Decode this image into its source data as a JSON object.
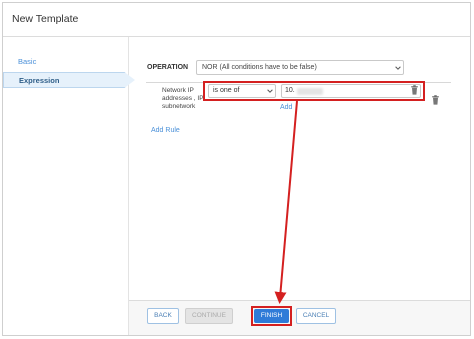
{
  "window": {
    "title": "New Template"
  },
  "sidebar": {
    "items": [
      {
        "label": "Basic",
        "active": false
      },
      {
        "label": "Expression",
        "active": true
      }
    ]
  },
  "operation": {
    "label": "OPERATION",
    "selected": "NOR (All conditions have to be false)"
  },
  "rule": {
    "field_label": "Network IP addresses , IP subnetwork",
    "condition": "is one of",
    "value": "10.",
    "add_label": "Add"
  },
  "add_rule_label": "Add Rule",
  "footer": {
    "back": "BACK",
    "continue": "CONTINUE",
    "finish": "FINISH",
    "cancel": "CANCEL"
  },
  "colors": {
    "accent": "#2f7bd8",
    "link": "#4a90d9",
    "highlight": "#d42020",
    "nav_active_bg": "#e6f1fb"
  },
  "icons": [
    "chevron-down-icon",
    "trash-icon",
    "arrow-annotation"
  ]
}
